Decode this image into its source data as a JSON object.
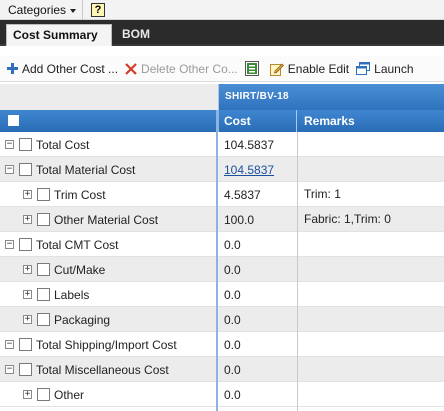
{
  "menubar": {
    "categories_label": "Categories",
    "help_label": "?"
  },
  "tabs": [
    {
      "label": "Cost Summary",
      "active": true
    },
    {
      "label": "BOM",
      "active": false
    }
  ],
  "toolbar": {
    "add_label": "Add Other Cost ...",
    "delete_label": "Delete Other Co...",
    "enable_edit_label": "Enable Edit",
    "launch_label": "Launch"
  },
  "grid": {
    "group_header": "SHIRT/BV-18",
    "columns": {
      "cost": "Cost",
      "remarks": "Remarks"
    },
    "rows": [
      {
        "label": "Total Cost",
        "cost": "104.5837",
        "remarks": ""
      },
      {
        "label": "Total Material Cost",
        "cost": "104.5837",
        "remarks": ""
      },
      {
        "label": "Trim Cost",
        "cost": "4.5837",
        "remarks": "Trim: 1"
      },
      {
        "label": "Other Material Cost",
        "cost": "100.0",
        "remarks": "Fabric: 1,Trim: 0"
      },
      {
        "label": "Total CMT Cost",
        "cost": "0.0",
        "remarks": ""
      },
      {
        "label": "Cut/Make",
        "cost": "0.0",
        "remarks": ""
      },
      {
        "label": "Labels",
        "cost": "0.0",
        "remarks": ""
      },
      {
        "label": "Packaging",
        "cost": "0.0",
        "remarks": ""
      },
      {
        "label": "Total Shipping/Import Cost",
        "cost": "0.0",
        "remarks": ""
      },
      {
        "label": "Total Miscellaneous Cost",
        "cost": "0.0",
        "remarks": ""
      },
      {
        "label": "Other",
        "cost": "0.0",
        "remarks": ""
      }
    ]
  },
  "colors": {
    "header_blue": "#2f73be",
    "link_blue": "#1a4f9e",
    "tab_bar": "#2b2b2b"
  }
}
